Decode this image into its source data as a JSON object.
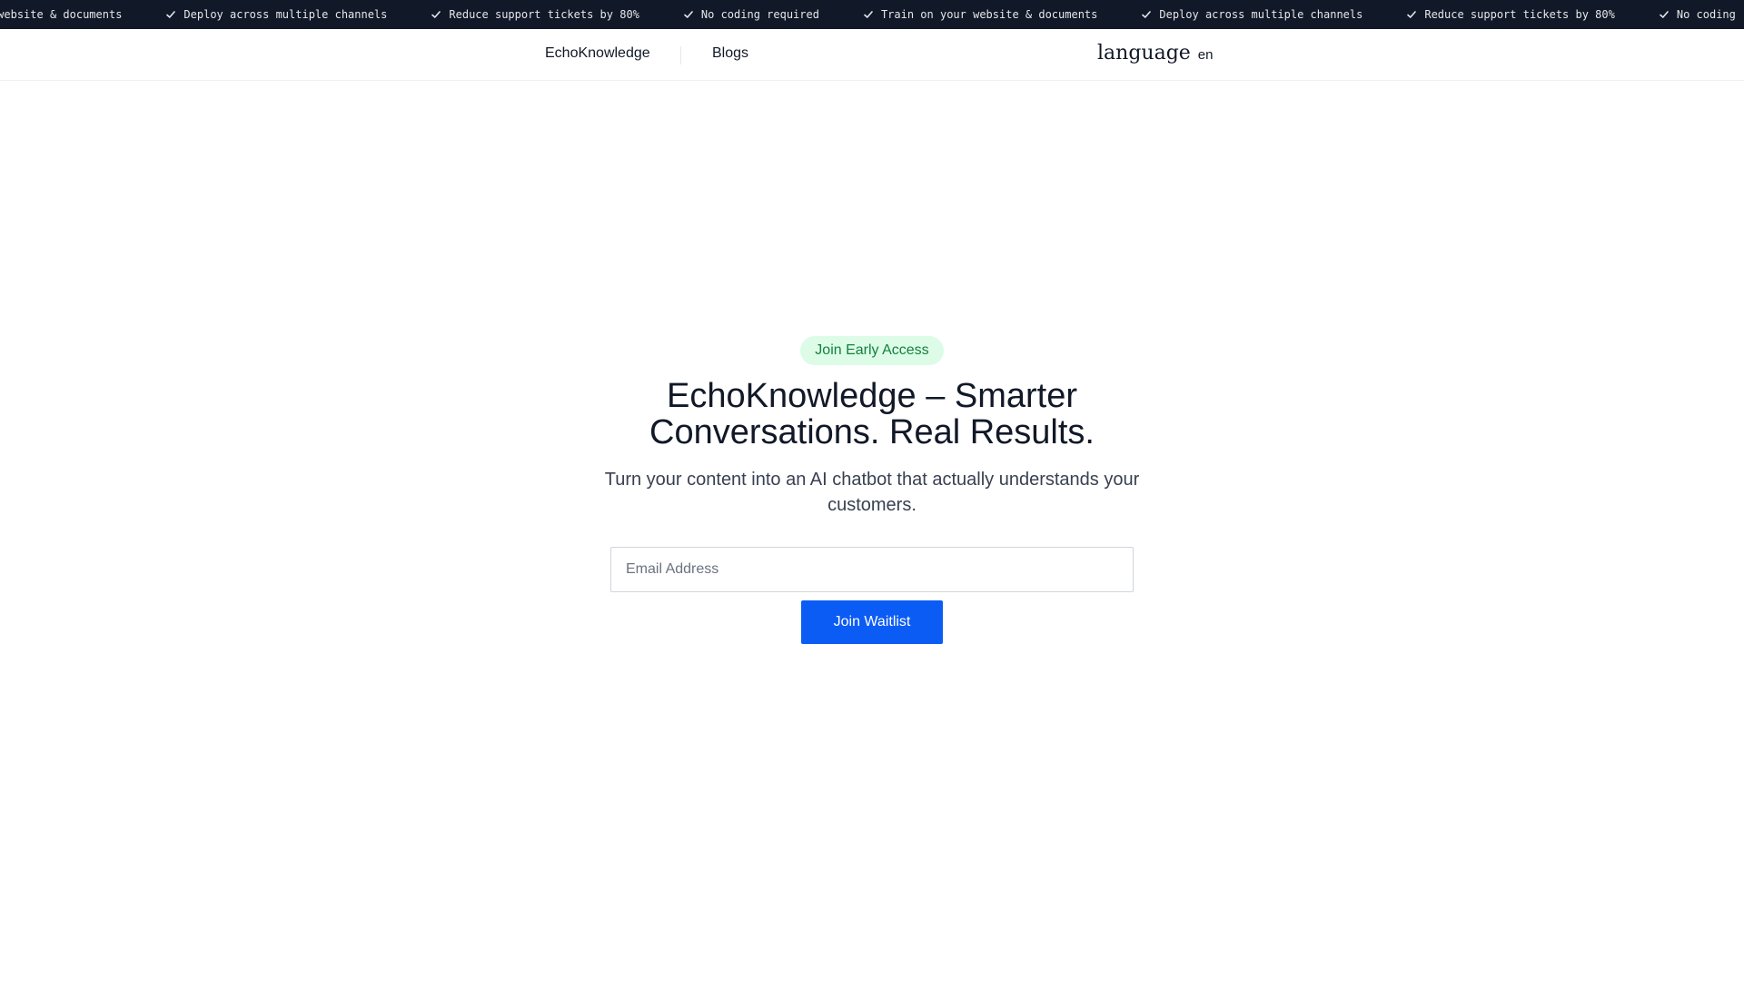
{
  "ticker": {
    "items": [
      "Train on your website & documents",
      "Deploy across multiple channels",
      "Reduce support tickets by 80%",
      "No coding required",
      "Train on your website & documents",
      "Deploy across multiple channels",
      "Reduce support tickets by 80%",
      "No coding required"
    ],
    "icon": "check-icon"
  },
  "header": {
    "brand": "EchoKnowledge",
    "nav": [
      {
        "label": "Blogs"
      }
    ],
    "language": {
      "icon_text": "language",
      "code": "en"
    }
  },
  "hero": {
    "badge": "Join Early Access",
    "title": "EchoKnowledge – Smarter Conversations. Real Results.",
    "subtitle": "Turn your content into an AI chatbot that actually understands your customers.",
    "email_placeholder": "Email Address",
    "email_value": "",
    "cta_label": "Join Waitlist"
  },
  "colors": {
    "ticker_bg": "#111827",
    "badge_bg": "#dcfce7",
    "badge_text": "#15803d",
    "cta_bg": "#0b5cf5"
  }
}
